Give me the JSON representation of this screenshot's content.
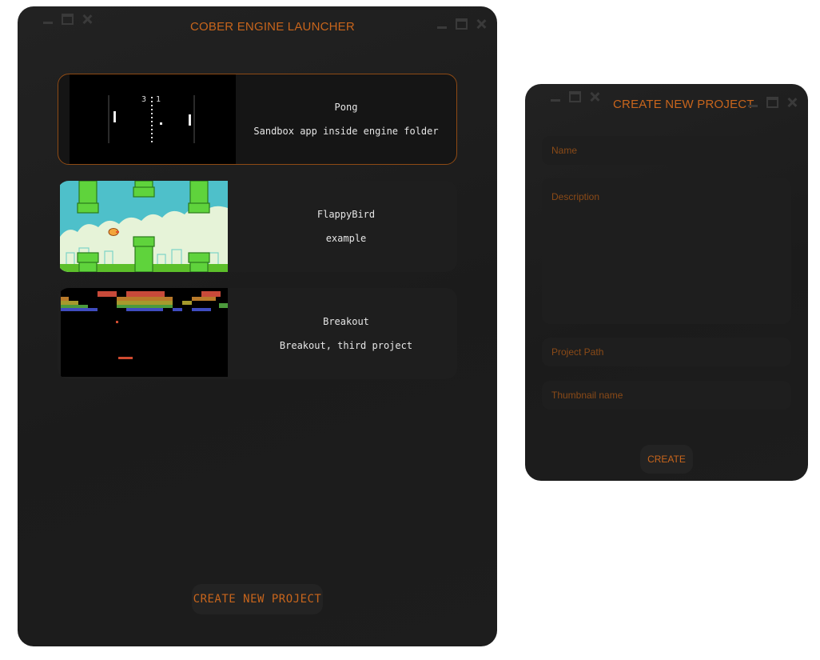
{
  "launcher": {
    "title": "COBER ENGINE LAUNCHER",
    "create_button": "CREATE NEW PROJECT",
    "projects": [
      {
        "name": "Pong",
        "description": "Sandbox app inside engine folder",
        "score": "3 1"
      },
      {
        "name": "FlappyBird",
        "description": "example"
      },
      {
        "name": "Breakout",
        "description": "Breakout, third project"
      }
    ]
  },
  "creator": {
    "title": "CREATE NEW PROJECT",
    "fields": {
      "name_placeholder": "Name",
      "description_placeholder": "Description",
      "path_placeholder": "Project Path",
      "thumbnail_placeholder": "Thumbnail name"
    },
    "create_button": "CREATE"
  },
  "colors": {
    "accent": "#c8651c",
    "window_bg": "#1f1f1f",
    "card_bg": "#1e1e1e",
    "selected_border": "#8e4a14",
    "placeholder": "#8a4a17"
  },
  "icons": [
    "minimize-icon",
    "maximize-icon",
    "close-icon"
  ]
}
